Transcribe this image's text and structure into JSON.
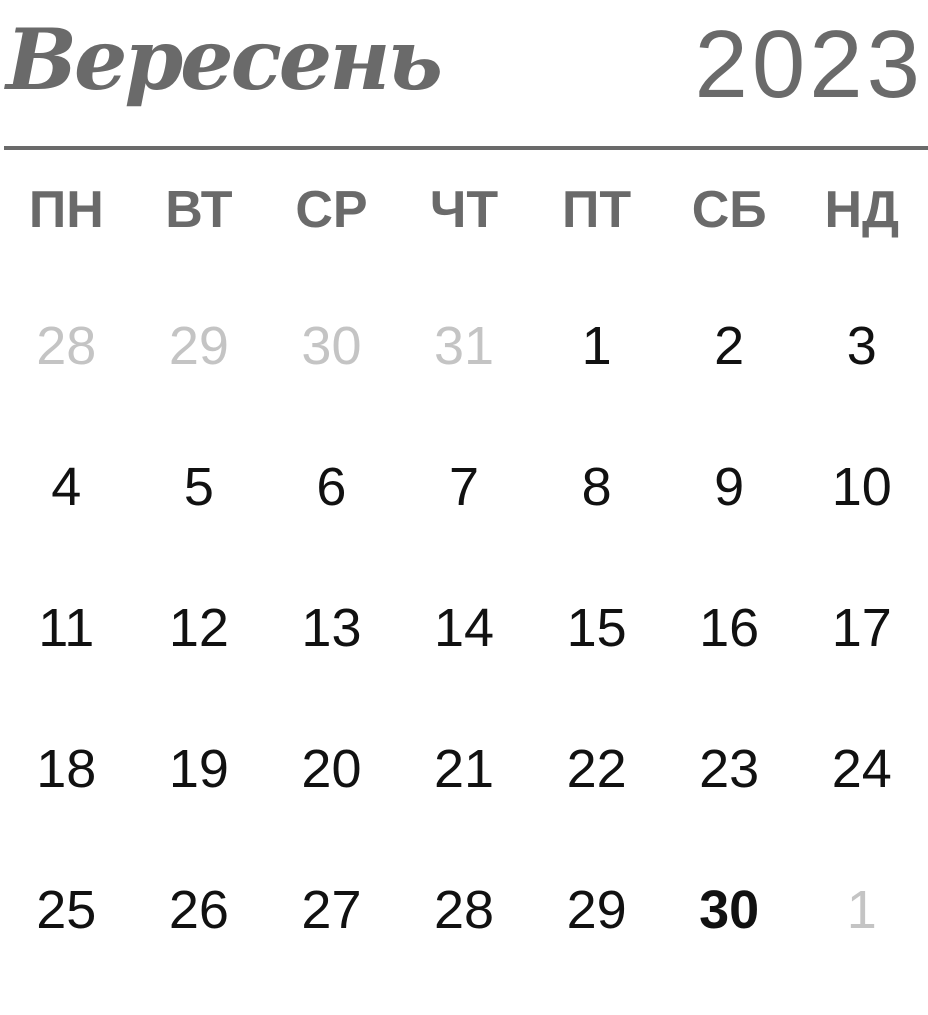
{
  "header": {
    "month": "Вересень",
    "year": "2023"
  },
  "weekdays": [
    "ПН",
    "ВТ",
    "СР",
    "ЧТ",
    "ПТ",
    "СБ",
    "НД"
  ],
  "weeks": [
    [
      {
        "day": "28",
        "muted": true
      },
      {
        "day": "29",
        "muted": true
      },
      {
        "day": "30",
        "muted": true
      },
      {
        "day": "31",
        "muted": true
      },
      {
        "day": "1"
      },
      {
        "day": "2"
      },
      {
        "day": "3"
      }
    ],
    [
      {
        "day": "4"
      },
      {
        "day": "5"
      },
      {
        "day": "6"
      },
      {
        "day": "7"
      },
      {
        "day": "8"
      },
      {
        "day": "9"
      },
      {
        "day": "10"
      }
    ],
    [
      {
        "day": "11"
      },
      {
        "day": "12"
      },
      {
        "day": "13"
      },
      {
        "day": "14"
      },
      {
        "day": "15"
      },
      {
        "day": "16"
      },
      {
        "day": "17"
      }
    ],
    [
      {
        "day": "18"
      },
      {
        "day": "19"
      },
      {
        "day": "20"
      },
      {
        "day": "21"
      },
      {
        "day": "22"
      },
      {
        "day": "23"
      },
      {
        "day": "24"
      }
    ],
    [
      {
        "day": "25"
      },
      {
        "day": "26"
      },
      {
        "day": "27"
      },
      {
        "day": "28"
      },
      {
        "day": "29"
      },
      {
        "day": "30",
        "highlight": true
      },
      {
        "day": "1",
        "muted": true
      }
    ]
  ],
  "colors": {
    "header": "#6a6a6a",
    "day": "#111111",
    "muted": "#c4c4c4"
  }
}
